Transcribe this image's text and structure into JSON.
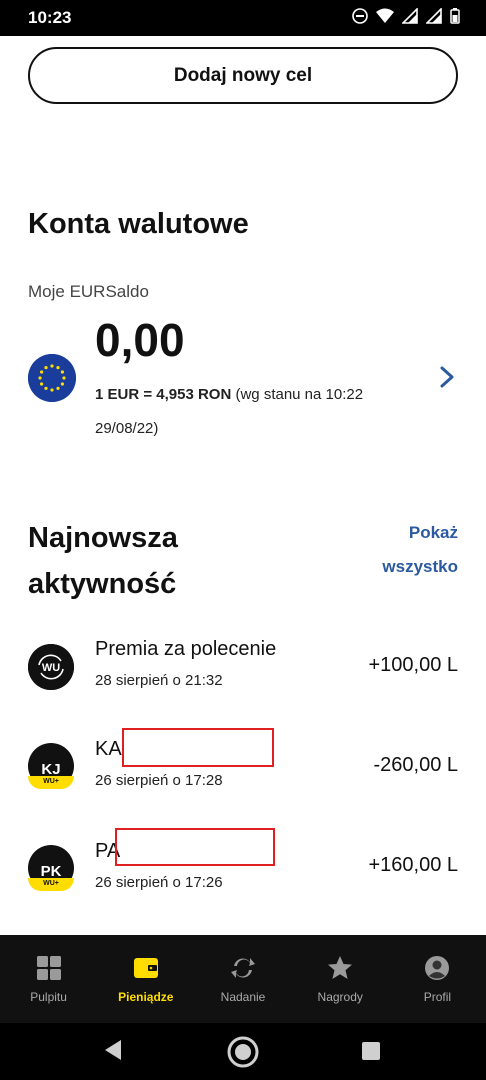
{
  "status_bar": {
    "time": "10:23"
  },
  "add_goal": {
    "label": "Dodaj nowy cel"
  },
  "accounts": {
    "title": "Konta walutowe",
    "label": "Moje  EURSaldo",
    "balance": "0,00",
    "rate_bold": "1 EUR = 4,953 RON",
    "rate_note": " (wg stanu na 10:22 29/08/22)"
  },
  "activity": {
    "title_line1": "Najnowsza",
    "title_line2": "aktywność",
    "show_all_line1": "Pokaż",
    "show_all_line2": "wszystko",
    "items": [
      {
        "icon": "wu-refer-icon",
        "name": "Premia za polecenie",
        "date": "28 sierpień o 21:32",
        "amount": "+100,00 L"
      },
      {
        "initials": "KJ",
        "badge": "WU+",
        "name": "KA",
        "date": "26 sierpień o 17:28",
        "amount": "-260,00 L"
      },
      {
        "initials": "PK",
        "badge": "WU+",
        "name": "PA",
        "date": "26 sierpień o 17:26",
        "amount": "+160,00 L"
      }
    ]
  },
  "bottom_nav": [
    {
      "label": "Pulpitu",
      "icon": "dashboard-icon"
    },
    {
      "label": "Pieniądze",
      "icon": "wallet-icon",
      "active": true
    },
    {
      "label": "Nadanie",
      "icon": "transfer-icon"
    },
    {
      "label": "Nagrody",
      "icon": "star-icon"
    },
    {
      "label": "Profil",
      "icon": "profile-icon"
    }
  ],
  "colors": {
    "accent": "#ffdd00",
    "link": "#2c5aa0",
    "nav_bg": "#111111",
    "redaction": "#e02020"
  }
}
